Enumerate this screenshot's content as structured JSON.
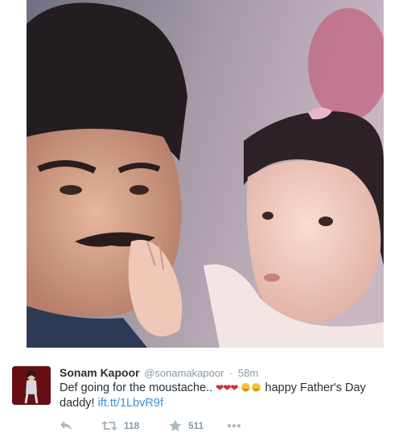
{
  "tweet": {
    "display_name": "Sonam Kapoor",
    "handle": "@sonamakapoor",
    "separator": "·",
    "time": "58m",
    "text_part1": "Def going for the moustache..",
    "text_part2": "happy Father's Day daddy!",
    "link": "ift.tt/1LbvR9f",
    "emoji": {
      "hearts": "❤❤❤",
      "smiles": [
        "smile-emoji",
        "smile-emoji"
      ]
    }
  },
  "actions": {
    "reply_icon": "reply-icon",
    "retweet_icon": "retweet-icon",
    "retweet_count": "118",
    "favorite_icon": "star-icon",
    "favorite_count": "511",
    "more_icon": "more-icon"
  },
  "colors": {
    "link": "#3b94d9",
    "muted": "#8899a6",
    "icon": "#aab8c2",
    "heart": "#d42a3c",
    "text": "#292f33"
  }
}
